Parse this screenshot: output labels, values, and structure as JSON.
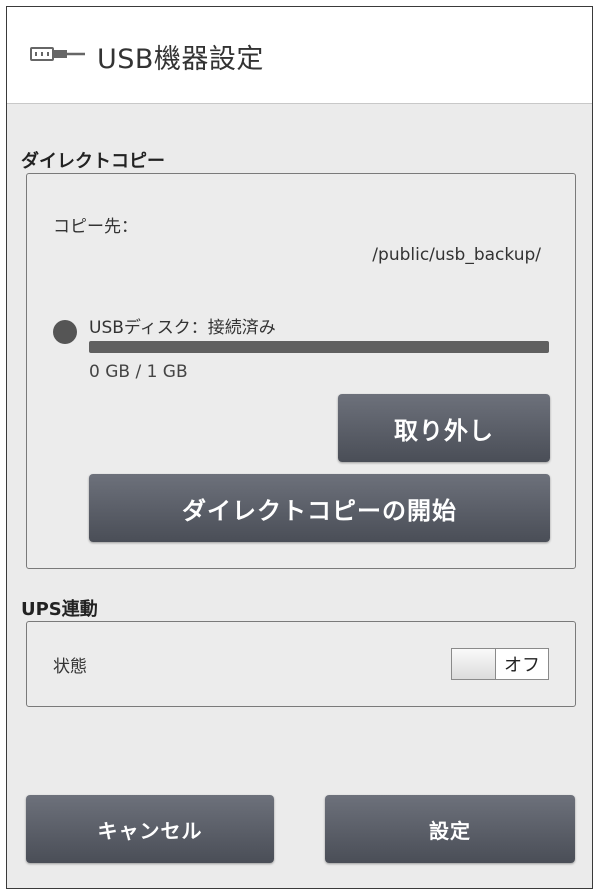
{
  "header": {
    "title": "USB機器設定",
    "icon": "usb-plug-icon"
  },
  "direct_copy": {
    "section_title": "ダイレクトコピー",
    "dest_label": "コピー先：",
    "dest_path": "/public/usb_backup/",
    "disk_status": "USBディスク：接続済み",
    "usage_text": "0 GB / 1 GB",
    "usage_fraction": 0,
    "remove_button": "取り外し",
    "start_button": "ダイレクトコピーの開始"
  },
  "ups": {
    "section_title": "UPS連動",
    "state_label": "状態",
    "toggle_value": "オフ"
  },
  "footer": {
    "cancel_button": "キャンセル",
    "set_button": "設定"
  },
  "colors": {
    "button": "#555a63",
    "panel_border": "#7a7a7a",
    "background": "#ebebeb"
  }
}
